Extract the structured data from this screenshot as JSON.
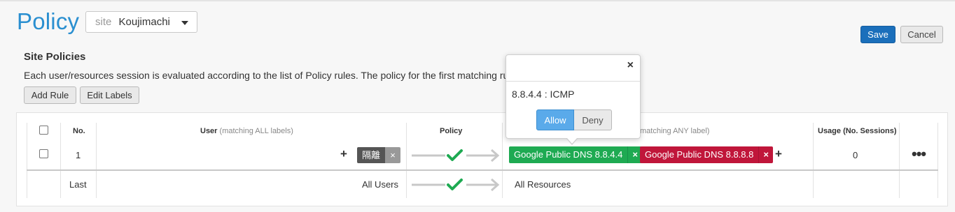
{
  "page": {
    "title": "Policy"
  },
  "site_selector": {
    "label": "site",
    "value": "Koujimachi"
  },
  "actions": {
    "save": "Save",
    "cancel": "Cancel"
  },
  "section": {
    "title": "Site Policies",
    "description": "Each user/resources session is evaluated according to the list of Policy rules. The policy for the first matching rule",
    "add_rule": "Add Rule",
    "edit_labels": "Edit Labels"
  },
  "table": {
    "headers": {
      "no": "No.",
      "user": "User",
      "user_sub": "(matching ALL labels)",
      "policy": "Policy",
      "resource_sub": "matching ANY label)",
      "usage": "Usage (No. Sessions)"
    },
    "rows": [
      {
        "no": "1",
        "user_label": "隔離",
        "resources": [
          {
            "label": "Google Public DNS 8.8.4.4",
            "color": "#1eaa52"
          },
          {
            "label": "Google Public DNS 8.8.8.8",
            "color": "#c0163a"
          }
        ],
        "usage": "0"
      }
    ],
    "last_row": {
      "no": "Last",
      "user": "All Users",
      "resource": "All Resources"
    }
  },
  "popover": {
    "text": "8.8.4.4 : ICMP",
    "allow": "Allow",
    "deny": "Deny",
    "close": "×"
  },
  "icons": {
    "close": "×",
    "plus": "+",
    "more": "•••"
  }
}
